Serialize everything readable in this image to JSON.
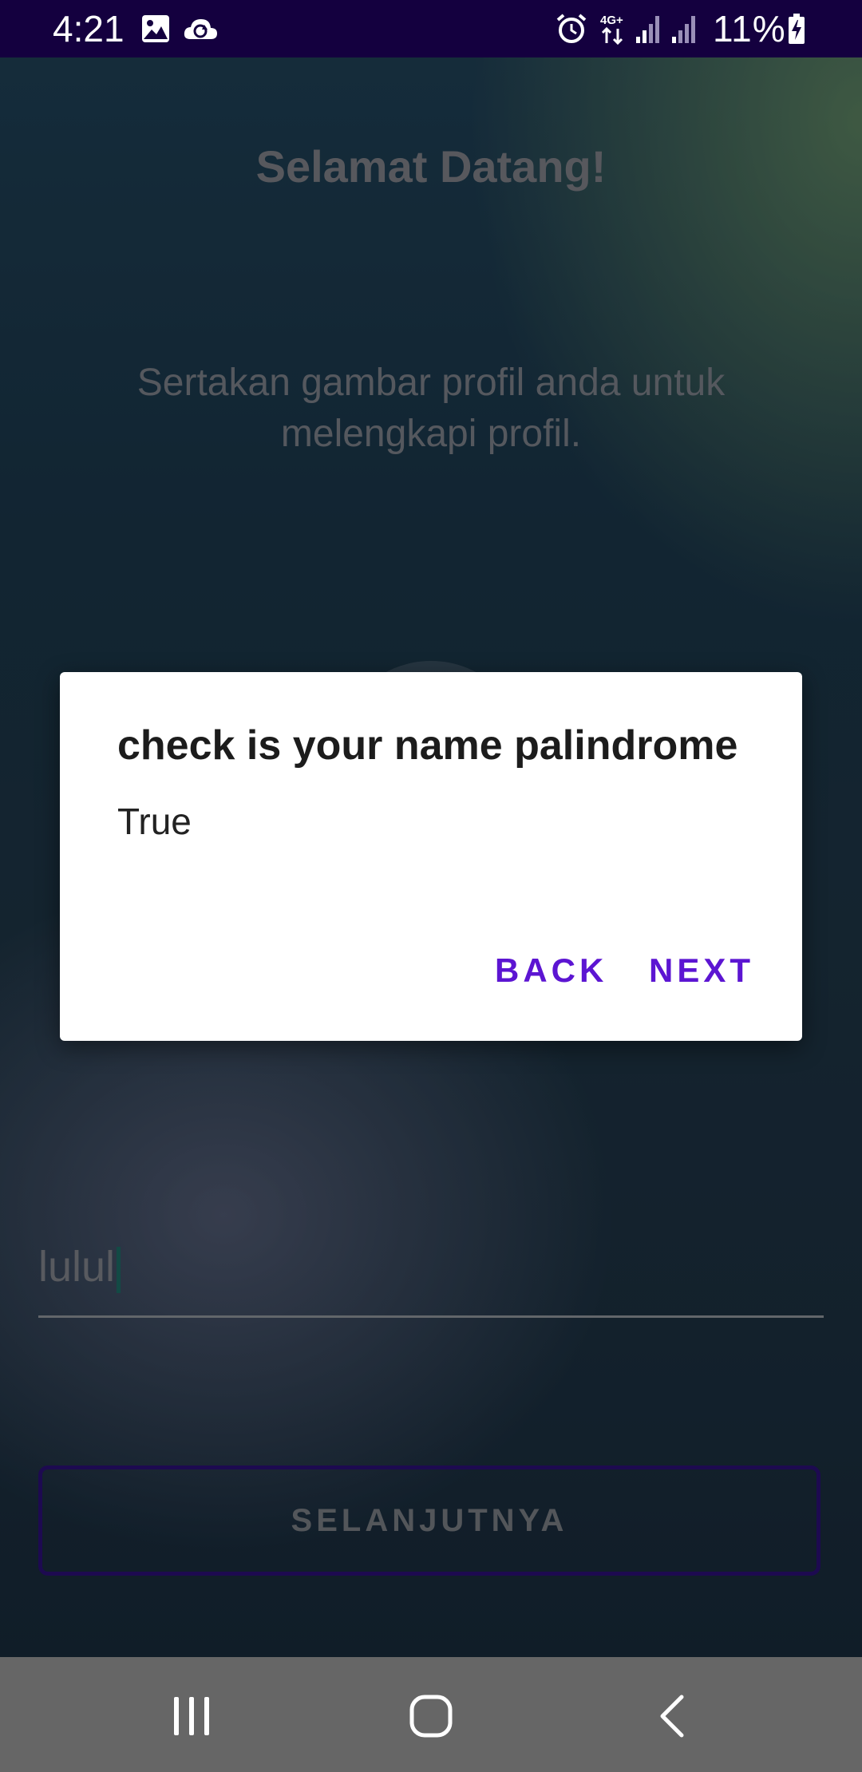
{
  "status_bar": {
    "time": "4:21",
    "battery_percent": "11%",
    "icons": [
      "gallery-icon",
      "cloud-sync-icon",
      "alarm-icon",
      "network-4g-icon",
      "signal-icon",
      "signal-icon-2",
      "battery-charging-icon"
    ],
    "background_color": "#14003f"
  },
  "welcome": {
    "title": "Selamat Datang!",
    "subtitle": "Sertakan gambar profil anda untuk melengkapi profil."
  },
  "name_input": {
    "value": "lulul"
  },
  "next_button": {
    "label": "SELANJUTNYA",
    "border_color": "#2a0f73"
  },
  "dialog": {
    "title": "check is your name palindrome",
    "message": "True",
    "back_label": "BACK",
    "next_label": "NEXT",
    "button_color": "#5c15d2"
  },
  "nav_bar": {
    "icons": [
      "recent-apps-icon",
      "home-icon",
      "back-icon"
    ],
    "background_color": "#666666"
  }
}
